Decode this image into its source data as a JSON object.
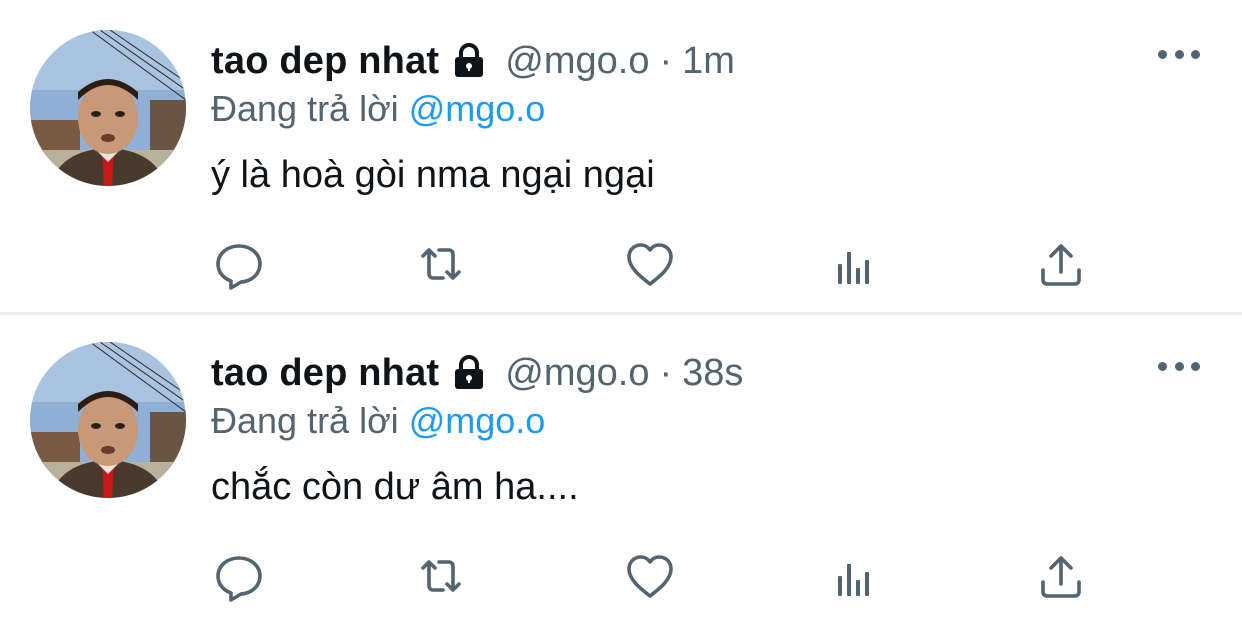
{
  "tweets": [
    {
      "display_name": "tao dep nhat",
      "handle": "@mgo.o",
      "separator": "·",
      "time": "1m",
      "replying_to_label": "Đang trả lời",
      "replying_to_handle": "@mgo.o",
      "text": "ý là hoà gòi nma ngại ngại",
      "actions": [
        "reply-icon",
        "retweet-icon",
        "like-icon",
        "analytics-icon",
        "share-icon"
      ]
    },
    {
      "display_name": "tao dep nhat",
      "handle": "@mgo.o",
      "separator": "·",
      "time": "38s",
      "replying_to_label": "Đang trả lời",
      "replying_to_handle": "@mgo.o",
      "text": "chắc còn dư âm ha....",
      "actions": [
        "reply-icon",
        "retweet-icon",
        "like-icon",
        "analytics-icon",
        "share-icon"
      ]
    }
  ],
  "colors": {
    "name": "#0f1419",
    "muted": "#536471",
    "link": "#1d9bf0",
    "divider": "#e6ecf0"
  }
}
